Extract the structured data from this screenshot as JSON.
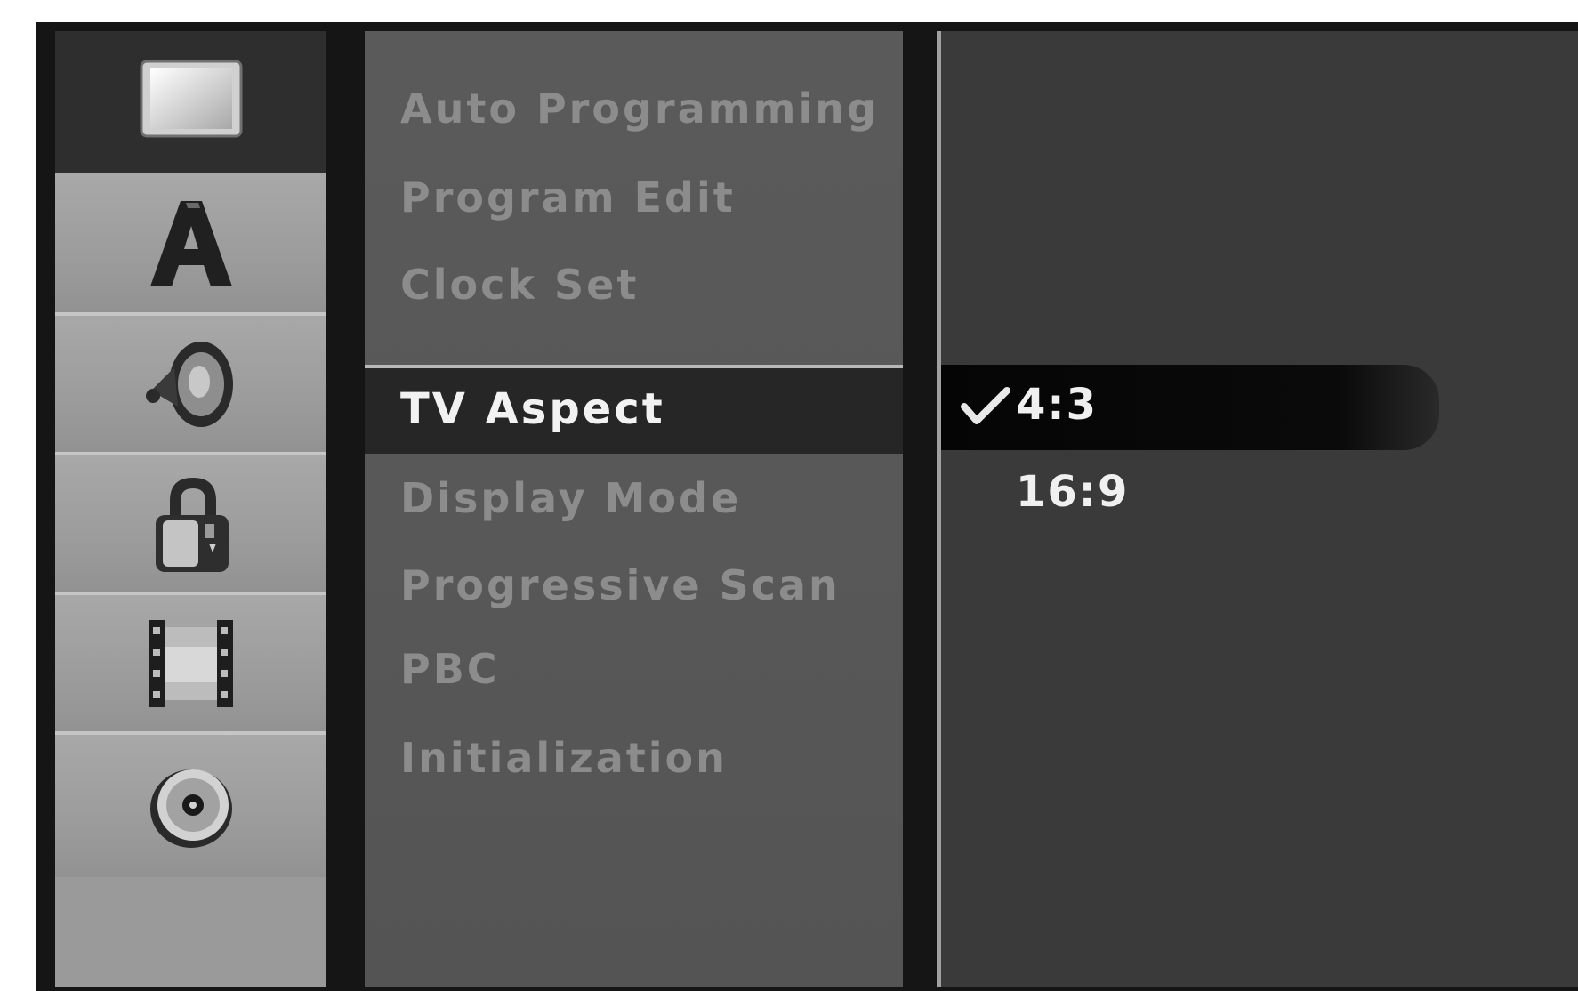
{
  "sidebar": {
    "items": [
      {
        "icon": "tv-screen-icon",
        "active": true
      },
      {
        "icon": "letter-a-icon",
        "active": false
      },
      {
        "icon": "speaker-icon",
        "active": false
      },
      {
        "icon": "padlock-icon",
        "active": false
      },
      {
        "icon": "film-strip-icon",
        "active": false
      },
      {
        "icon": "disc-icon",
        "active": false
      }
    ]
  },
  "menu": {
    "items": [
      {
        "label": "Auto Programming"
      },
      {
        "label": "Program Edit"
      },
      {
        "label": "Clock Set"
      },
      {
        "label": "TV Aspect"
      },
      {
        "label": "Display Mode"
      },
      {
        "label": "Progressive Scan"
      },
      {
        "label": "PBC"
      },
      {
        "label": "Initialization"
      }
    ],
    "selected_index": 3
  },
  "options": {
    "items": [
      {
        "label": "4:3",
        "checked": true
      },
      {
        "label": "16:9",
        "checked": false
      }
    ]
  },
  "colors": {
    "background": "#151515",
    "sidebar": "#9a9a9a",
    "menu_panel": "#585858",
    "selected_row": "#262626",
    "option_highlight": "#050505",
    "inactive_text": "#8c8c8c",
    "active_text": "#f2f2f2"
  }
}
